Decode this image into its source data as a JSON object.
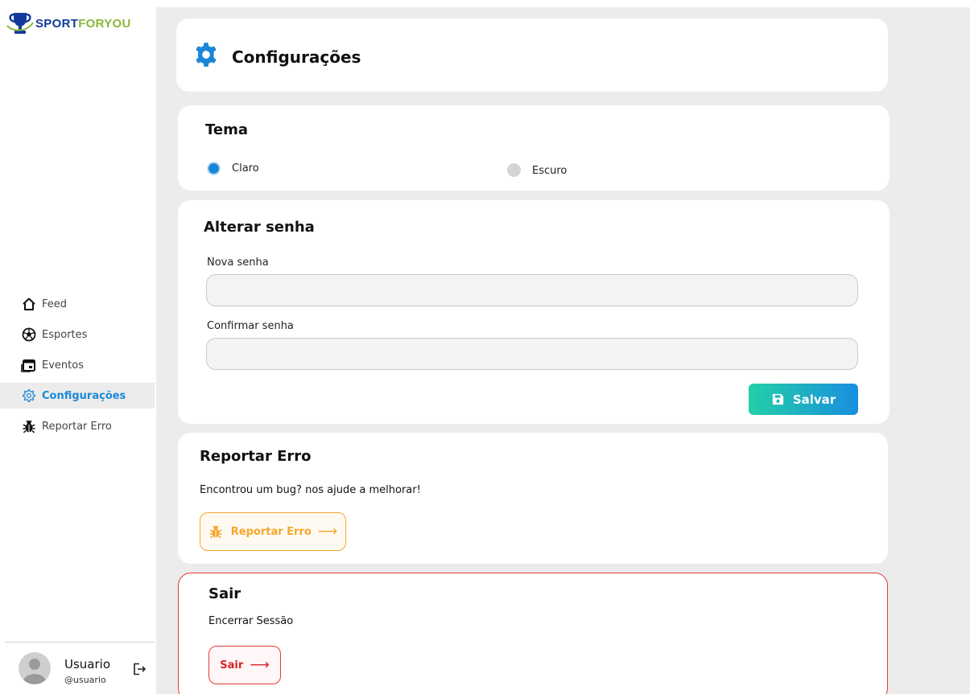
{
  "brand": {
    "part1": "SPORT",
    "part2": "FORYOU"
  },
  "colors": {
    "accent": "#1a86d8",
    "brand_blue": "#123a9a",
    "brand_green": "#8ab63a",
    "warning": "#f5a72c",
    "danger": "#e23b3b"
  },
  "sidebar": {
    "items": [
      {
        "label": "Feed",
        "icon": "home-icon"
      },
      {
        "label": "Esportes",
        "icon": "soccer-ball-icon"
      },
      {
        "label": "Eventos",
        "icon": "calendar-icon"
      },
      {
        "label": "Configurações",
        "icon": "gear-icon",
        "active": true
      },
      {
        "label": "Reportar Erro",
        "icon": "bug-icon"
      }
    ],
    "user": {
      "name": "Usuario",
      "handle": "@usuario"
    }
  },
  "page": {
    "title": "Configurações"
  },
  "theme": {
    "title": "Tema",
    "options": [
      {
        "label": "Claro",
        "selected": true
      },
      {
        "label": "Escuro",
        "selected": false
      }
    ]
  },
  "password": {
    "title": "Alterar senha",
    "new_label": "Nova senha",
    "new_value": "",
    "confirm_label": "Confirmar senha",
    "confirm_value": "",
    "save_label": "Salvar"
  },
  "report": {
    "title": "Reportar Erro",
    "description": "Encontrou um bug? nos ajude a melhorar!",
    "button_label": "Reportar Erro",
    "arrow": "⟶"
  },
  "logout": {
    "title": "Sair",
    "description": "Encerrar Sessão",
    "button_label": "Sair",
    "arrow": "⟶"
  }
}
